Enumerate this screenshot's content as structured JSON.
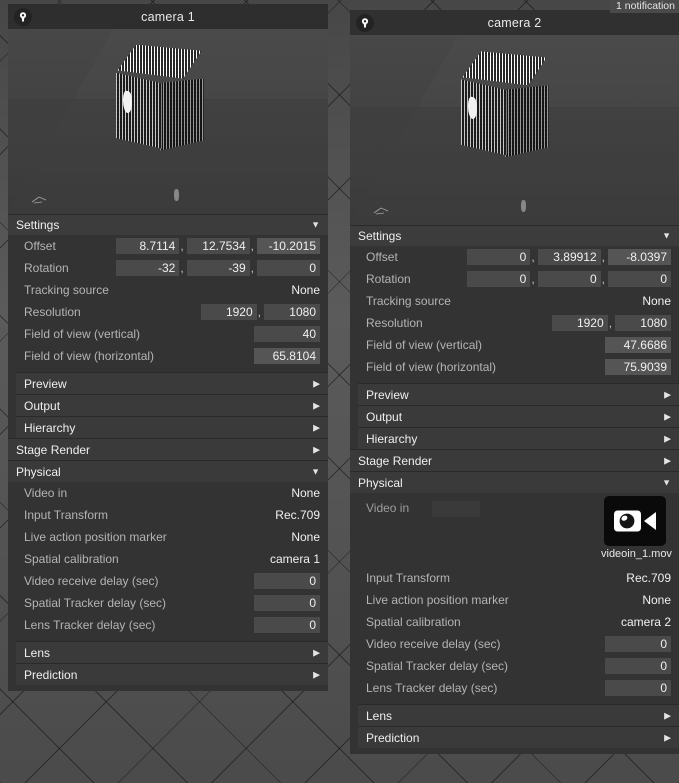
{
  "notification": {
    "text": "1 notification"
  },
  "panels": [
    {
      "id": "camera-1",
      "title": "camera 1",
      "icon": "camera-badge-icon",
      "settings": {
        "header": "Settings",
        "state": "expanded",
        "rows": [
          {
            "label": "Offset",
            "type": "vec3",
            "values": [
              "8.7114",
              "12.7534",
              "-10.2015"
            ]
          },
          {
            "label": "Rotation",
            "type": "vec3",
            "values": [
              "-32",
              "-39",
              "0"
            ]
          },
          {
            "label": "Tracking source",
            "type": "plain",
            "values": [
              "None"
            ]
          },
          {
            "label": "Resolution",
            "type": "vec2",
            "values": [
              "1920",
              "1080"
            ]
          },
          {
            "label": "Field of view (vertical)",
            "type": "field",
            "values": [
              "40"
            ]
          },
          {
            "label": "Field of view (horizontal)",
            "type": "field",
            "values": [
              "65.8104"
            ]
          }
        ]
      },
      "subsections": [
        {
          "label": "Preview",
          "state": "collapsed"
        },
        {
          "label": "Output",
          "state": "collapsed"
        },
        {
          "label": "Hierarchy",
          "state": "collapsed"
        }
      ],
      "stage_render": {
        "label": "Stage Render",
        "state": "collapsed"
      },
      "physical": {
        "header": "Physical",
        "state": "expanded",
        "video_in": {
          "label": "Video in",
          "value": "None",
          "has_thumbnail": false
        },
        "rows": [
          {
            "label": "Input Transform",
            "type": "plain",
            "values": [
              "Rec.709"
            ]
          },
          {
            "label": "Live action position marker",
            "type": "plain",
            "values": [
              "None"
            ]
          },
          {
            "label": "Spatial calibration",
            "type": "plain",
            "values": [
              "camera 1"
            ]
          },
          {
            "label": "Video receive delay (sec)",
            "type": "field",
            "values": [
              "0"
            ]
          },
          {
            "label": "Spatial Tracker delay (sec)",
            "type": "field",
            "values": [
              "0"
            ]
          },
          {
            "label": "Lens Tracker delay (sec)",
            "type": "field",
            "values": [
              "0"
            ]
          }
        ]
      },
      "footer_sections": [
        {
          "label": "Lens",
          "state": "collapsed"
        },
        {
          "label": "Prediction",
          "state": "collapsed"
        }
      ]
    },
    {
      "id": "camera-2",
      "title": "camera 2",
      "icon": "camera-badge-icon",
      "settings": {
        "header": "Settings",
        "state": "expanded",
        "rows": [
          {
            "label": "Offset",
            "type": "vec3",
            "values": [
              "0",
              "3.89912",
              "-8.0397"
            ]
          },
          {
            "label": "Rotation",
            "type": "vec3",
            "values": [
              "0",
              "0",
              "0"
            ]
          },
          {
            "label": "Tracking source",
            "type": "plain",
            "values": [
              "None"
            ]
          },
          {
            "label": "Resolution",
            "type": "vec2",
            "values": [
              "1920",
              "1080"
            ]
          },
          {
            "label": "Field of view (vertical)",
            "type": "field",
            "values": [
              "47.6686"
            ]
          },
          {
            "label": "Field of view (horizontal)",
            "type": "field",
            "values": [
              "75.9039"
            ]
          }
        ]
      },
      "subsections": [
        {
          "label": "Preview",
          "state": "collapsed"
        },
        {
          "label": "Output",
          "state": "collapsed"
        },
        {
          "label": "Hierarchy",
          "state": "collapsed"
        }
      ],
      "stage_render": {
        "label": "Stage Render",
        "state": "collapsed"
      },
      "physical": {
        "header": "Physical",
        "state": "expanded",
        "video_in": {
          "label": "Video in",
          "value": "",
          "has_thumbnail": true,
          "thumbnail_name": "videoin_1.mov",
          "thumbnail_icon": "video-camera-icon"
        },
        "rows": [
          {
            "label": "Input Transform",
            "type": "plain",
            "values": [
              "Rec.709"
            ]
          },
          {
            "label": "Live action position marker",
            "type": "plain",
            "values": [
              "None"
            ]
          },
          {
            "label": "Spatial calibration",
            "type": "plain",
            "values": [
              "camera 2"
            ]
          },
          {
            "label": "Video receive delay (sec)",
            "type": "field",
            "values": [
              "0"
            ]
          },
          {
            "label": "Spatial Tracker delay (sec)",
            "type": "field",
            "values": [
              "0"
            ]
          },
          {
            "label": "Lens Tracker delay (sec)",
            "type": "field",
            "values": [
              "0"
            ]
          }
        ]
      },
      "footer_sections": [
        {
          "label": "Lens",
          "state": "collapsed"
        },
        {
          "label": "Prediction",
          "state": "collapsed"
        }
      ]
    }
  ],
  "glyphs": {
    "arrow_collapsed": "▶",
    "arrow_expanded": "▼",
    "separator": ","
  },
  "colors": {
    "panel_bg": "#333333",
    "section_bg": "#3c3c3c",
    "field_bg": "#4a4a4a",
    "label": "#b4b4b4",
    "value": "#f0f0f0",
    "viewport_bg": "#464646"
  }
}
